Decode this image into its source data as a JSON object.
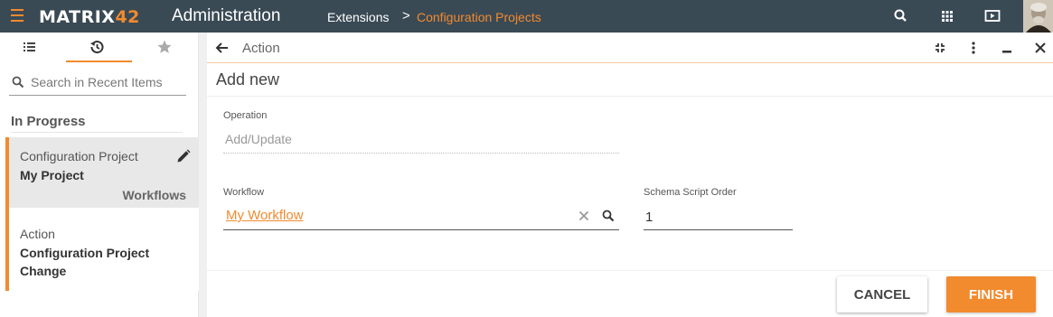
{
  "topbar": {
    "logo_main": "MATRIX",
    "logo_accent": "42",
    "app_title": "Administration",
    "breadcrumb": [
      "Extensions",
      "Configuration Projects"
    ],
    "breadcrumb_separator": ">",
    "icons": [
      "menu-icon",
      "search-icon",
      "apps-grid-icon",
      "presentation-icon"
    ],
    "accent_color": "#f28a2e",
    "bar_color": "#3a4a55"
  },
  "left_panel": {
    "tabs": [
      "list-icon",
      "history-icon",
      "star-icon"
    ],
    "active_tab": "history-icon",
    "search_placeholder": "Search in Recent Items",
    "section_title": "In Progress",
    "items": [
      {
        "type": "Configuration Project",
        "name": "My Project",
        "sub_label": "Workflows"
      },
      {
        "type": "Action",
        "name": "Configuration Project Change"
      }
    ]
  },
  "main": {
    "title": "Action",
    "subheader": "Add new",
    "operation": {
      "label": "Operation",
      "value": "Add/Update"
    },
    "workflow": {
      "label": "Workflow",
      "value": "My Workflow"
    },
    "schema_script_order": {
      "label": "Schema Script Order",
      "value": "1"
    },
    "buttons": {
      "cancel": "CANCEL",
      "finish": "FINISH"
    }
  }
}
